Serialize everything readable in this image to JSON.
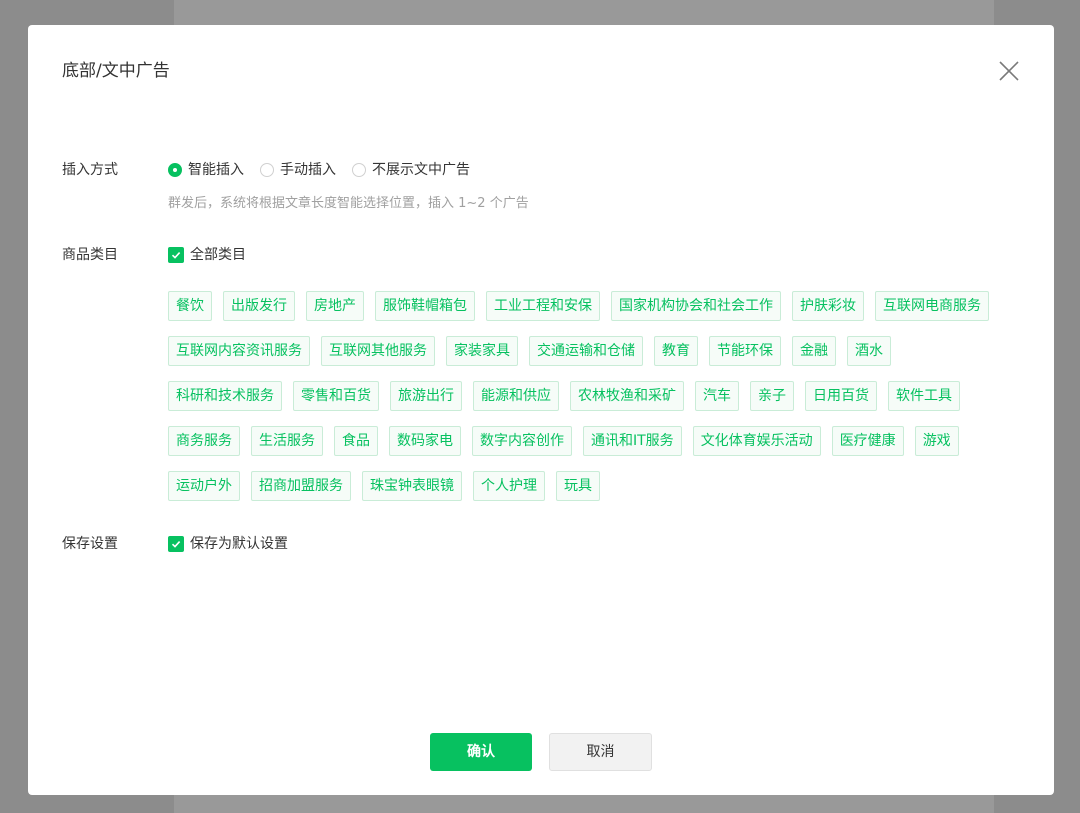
{
  "colors": {
    "accent": "#07c160",
    "tag_bg": "#f6fcf8",
    "tag_border": "#c9ecd7",
    "text": "#353535",
    "hint": "#a0a0a0"
  },
  "dialog": {
    "title": "底部/文中广告",
    "close_icon": "close-icon"
  },
  "insert_mode": {
    "label": "插入方式",
    "options": [
      {
        "label": "智能插入",
        "checked": true
      },
      {
        "label": "手动插入",
        "checked": false
      },
      {
        "label": "不展示文中广告",
        "checked": false
      }
    ],
    "hint": "群发后，系统将根据文章长度智能选择位置，插入 1~2 个广告"
  },
  "categories": {
    "label": "商品类目",
    "all_label": "全部类目",
    "all_checked": true,
    "tags": [
      "餐饮",
      "出版发行",
      "房地产",
      "服饰鞋帽箱包",
      "工业工程和安保",
      "国家机构协会和社会工作",
      "护肤彩妆",
      "互联网电商服务",
      "互联网内容资讯服务",
      "互联网其他服务",
      "家装家具",
      "交通运输和仓储",
      "教育",
      "节能环保",
      "金融",
      "酒水",
      "科研和技术服务",
      "零售和百货",
      "旅游出行",
      "能源和供应",
      "农林牧渔和采矿",
      "汽车",
      "亲子",
      "日用百货",
      "软件工具",
      "商务服务",
      "生活服务",
      "食品",
      "数码家电",
      "数字内容创作",
      "通讯和IT服务",
      "文化体育娱乐活动",
      "医疗健康",
      "游戏",
      "运动户外",
      "招商加盟服务",
      "珠宝钟表眼镜",
      "个人护理",
      "玩具"
    ]
  },
  "save_settings": {
    "label": "保存设置",
    "option_label": "保存为默认设置",
    "checked": true
  },
  "footer": {
    "confirm_label": "确认",
    "cancel_label": "取消"
  }
}
